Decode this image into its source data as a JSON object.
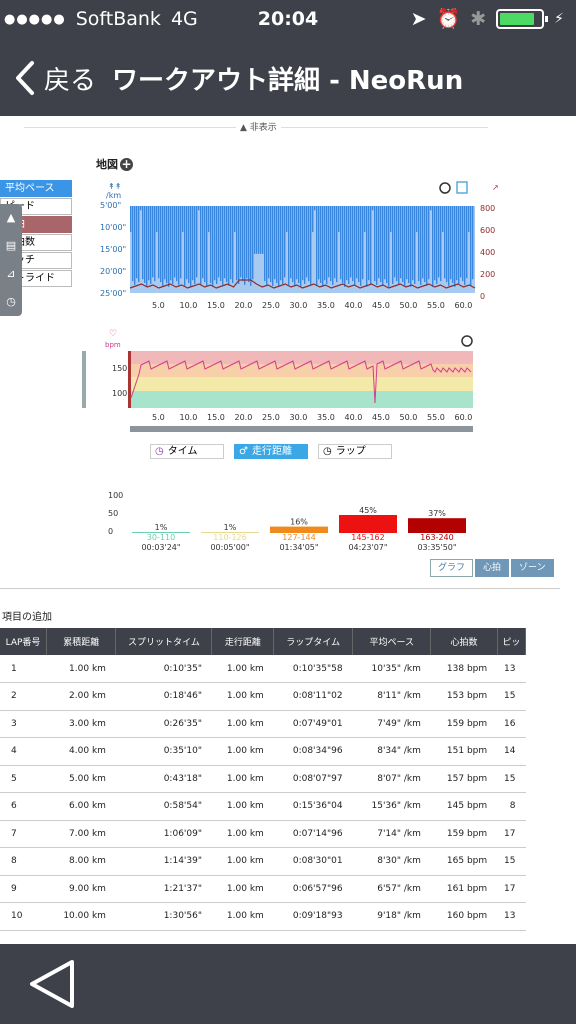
{
  "status": {
    "carrier": "SoftBank",
    "network": "4G",
    "time": "20:04"
  },
  "nav": {
    "back": "戻る",
    "title": "ワークアウト詳細 - NeoRun"
  },
  "hide_label": "非表示",
  "map_label": "地図",
  "metrics": [
    "平均ペース",
    "ピード",
    "心拍",
    "心拍数",
    "ピッチ",
    "ストライド"
  ],
  "pace_chart": {
    "y_left_unit": "/km",
    "y_left_ticks": [
      "5'00\"",
      "10'00\"",
      "15'00\"",
      "20'00\"",
      "25'00\""
    ],
    "y_right_ticks": [
      "800",
      "600",
      "400",
      "200",
      "0"
    ],
    "x_ticks": [
      "5.0",
      "10.0",
      "15.0",
      "20.0",
      "25.0",
      "30.0",
      "35.0",
      "40.0",
      "45.0",
      "50.0",
      "55.0",
      "60.0"
    ]
  },
  "hr_chart": {
    "unit": "bpm",
    "y_ticks": [
      "150",
      "100"
    ],
    "x_ticks": [
      "5.0",
      "10.0",
      "15.0",
      "20.0",
      "25.0",
      "30.0",
      "35.0",
      "40.0",
      "45.0",
      "50.0",
      "55.0",
      "60.0"
    ]
  },
  "tabs": {
    "time": "タイム",
    "distance": "走行距離",
    "lap": "ラップ"
  },
  "chart_data": {
    "type": "bar",
    "title": "",
    "categories": [
      "30-110",
      "110-126",
      "127-144",
      "145-162",
      "163-240"
    ],
    "values": [
      1,
      1,
      16,
      45,
      37
    ],
    "value_labels": [
      "1%",
      "1%",
      "16%",
      "45%",
      "37%"
    ],
    "durations": [
      "00:03'24\"",
      "00:05'00\"",
      "01:34'05\"",
      "04:23'07\"",
      "03:35'50\""
    ],
    "colors": [
      "#6ccfb0",
      "#e8d990",
      "#f08a1e",
      "#ee1111",
      "#b30000"
    ],
    "y_ticks": [
      "100",
      "50",
      "0"
    ],
    "ylim": [
      0,
      100
    ]
  },
  "zone_buttons": [
    "グラフ",
    "心拍",
    "ゾーン"
  ],
  "add_field": "項目の追加",
  "table": {
    "headers": [
      "LAP番号",
      "累積距離",
      "スプリットタイム",
      "走行距離",
      "ラップタイム",
      "平均ペース",
      "心拍数",
      "ピッ"
    ],
    "rows": [
      [
        "1",
        "1.00 km",
        "0:10'35\"",
        "1.00 km",
        "0:10'35\"58",
        "10'35\" /km",
        "138 bpm",
        "13"
      ],
      [
        "2",
        "2.00 km",
        "0:18'46\"",
        "1.00 km",
        "0:08'11\"02",
        "8'11\" /km",
        "153 bpm",
        "15"
      ],
      [
        "3",
        "3.00 km",
        "0:26'35\"",
        "1.00 km",
        "0:07'49\"01",
        "7'49\" /km",
        "159 bpm",
        "16"
      ],
      [
        "4",
        "4.00 km",
        "0:35'10\"",
        "1.00 km",
        "0:08'34\"96",
        "8'34\" /km",
        "151 bpm",
        "14"
      ],
      [
        "5",
        "5.00 km",
        "0:43'18\"",
        "1.00 km",
        "0:08'07\"97",
        "8'07\" /km",
        "157 bpm",
        "15"
      ],
      [
        "6",
        "6.00 km",
        "0:58'54\"",
        "1.00 km",
        "0:15'36\"04",
        "15'36\" /km",
        "145 bpm",
        "8"
      ],
      [
        "7",
        "7.00 km",
        "1:06'09\"",
        "1.00 km",
        "0:07'14\"96",
        "7'14\" /km",
        "159 bpm",
        "17"
      ],
      [
        "8",
        "8.00 km",
        "1:14'39\"",
        "1.00 km",
        "0:08'30\"01",
        "8'30\" /km",
        "165 bpm",
        "15"
      ],
      [
        "9",
        "9.00 km",
        "1:21'37\"",
        "1.00 km",
        "0:06'57\"96",
        "6'57\" /km",
        "161 bpm",
        "17"
      ],
      [
        "10",
        "10.00 km",
        "1:30'56\"",
        "1.00 km",
        "0:09'18\"93",
        "9'18\" /km",
        "160 bpm",
        "13"
      ]
    ]
  }
}
